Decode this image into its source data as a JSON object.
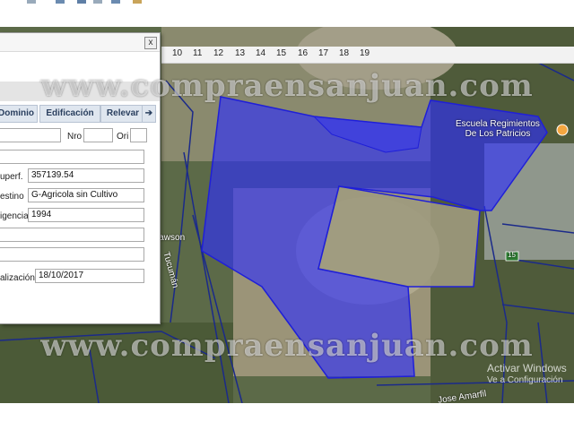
{
  "ruler": {
    "ticks": [
      "10",
      "11",
      "12",
      "13",
      "14",
      "15",
      "16",
      "17",
      "18",
      "19"
    ]
  },
  "map": {
    "poi_school": [
      "Escuela Regimientos",
      "De Los Patricios"
    ],
    "roads": [
      "Tucumán",
      "Dawson",
      "Jose Amarfil"
    ],
    "route_badge": "15",
    "polygon_color": "#2a2cff"
  },
  "watermark": "www.compraensanjuan.com",
  "windows_activation": [
    "Activar Windows",
    "Ve a Configuración"
  ],
  "panel": {
    "close_label": "x",
    "tabs": [
      "Dominio",
      "Edificación",
      "Relevar"
    ],
    "tab_arrow": "➔",
    "fields": {
      "nro_label": "Nro",
      "ori_label": "Ori",
      "superficie_label": "uperf.",
      "superficie_value": "357139.54",
      "destino_label": "estino",
      "destino_value": "G-Agricola sin Cultivo",
      "vigencia_label": "igencia",
      "vigencia_value": "1994",
      "actualizacion_label": "alización",
      "actualizacion_value": "18/10/2017"
    }
  }
}
